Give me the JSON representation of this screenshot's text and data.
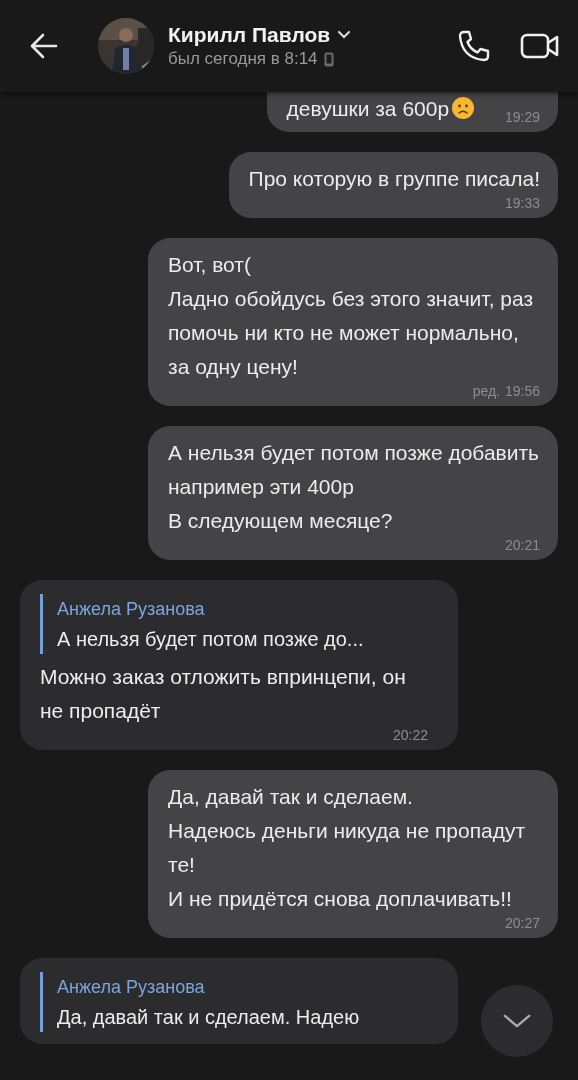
{
  "header": {
    "name": "Кирилл Павлов",
    "status": "был сегодня в 8:14",
    "via_mobile": true
  },
  "messages": [
    {
      "outgoing": true,
      "text": "девушки за 600р",
      "sad_emoji": true,
      "time": "19:29"
    },
    {
      "outgoing": true,
      "text": "Про которую в группе писала!",
      "time": "19:33"
    },
    {
      "outgoing": true,
      "text": "Вот, вот(\nЛадно обойдусь без этого значит, раз помочь ни кто не может нормально, за одну цену!",
      "edited": "ред.",
      "time": "19:56"
    },
    {
      "outgoing": true,
      "text": "А нельзя будет потом позже добавить например эти 400р\nВ следующем месяце?",
      "time": "20:21"
    },
    {
      "outgoing": false,
      "reply": {
        "author": "Анжела Рузанова",
        "text": "А нельзя будет потом позже до..."
      },
      "text": "Можно заказ отложить впринцепи, он не пропадёт",
      "time": "20:22"
    },
    {
      "outgoing": true,
      "text": "Да, давай так и сделаем.\nНадеюсь деньги никуда не пропадут те!\nИ не придётся снова доплачивать!!",
      "time": "20:27"
    },
    {
      "outgoing": false,
      "reply": {
        "author": "Анжела Рузанова",
        "text": "Да, давай так и сделаем. Надею"
      }
    }
  ]
}
